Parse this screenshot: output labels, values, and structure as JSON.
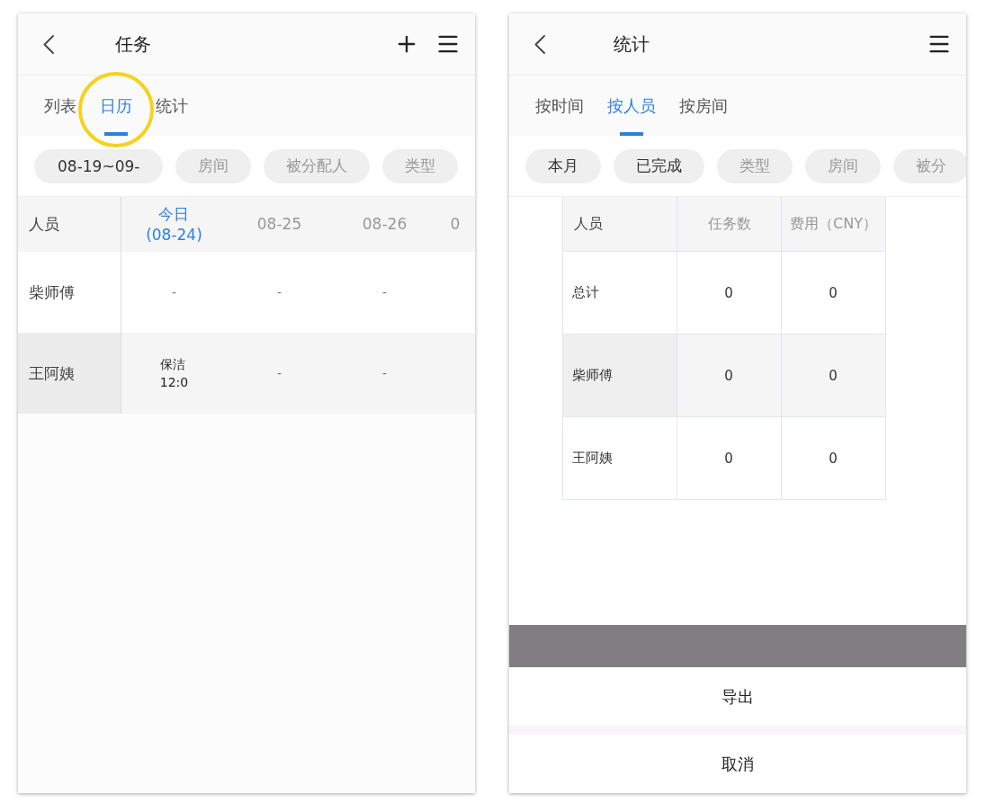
{
  "screens": [
    {
      "title": "任务",
      "add_button": true,
      "tabs": [
        {
          "label": "列表",
          "selected": false,
          "highlight": false
        },
        {
          "label": "日历",
          "selected": true,
          "highlight": true
        },
        {
          "label": "统计",
          "selected": false,
          "highlight": false
        }
      ],
      "filters": [
        {
          "label": "08-19~09-",
          "set": true
        },
        {
          "label": "房间",
          "set": false
        },
        {
          "label": "被分配人",
          "set": false
        },
        {
          "label": "类型",
          "set": false
        }
      ],
      "calendar": {
        "corner": "人员",
        "columns": [
          {
            "label": "今日\n(08-24)",
            "today": true
          },
          {
            "label": "08-25",
            "today": false
          },
          {
            "label": "08-26",
            "today": false
          },
          {
            "label": "0",
            "today": false
          }
        ],
        "rows": [
          {
            "name": "柴师傅",
            "shaded": false,
            "cells": [
              {
                "kind": "empty",
                "text": "-"
              },
              {
                "kind": "empty",
                "text": "-"
              },
              {
                "kind": "empty",
                "text": "-"
              }
            ]
          },
          {
            "name": "王阿姨",
            "shaded": true,
            "cells": [
              {
                "kind": "task",
                "title": "保洁",
                "time": "12:0"
              },
              {
                "kind": "empty",
                "text": "-"
              },
              {
                "kind": "empty",
                "text": "-"
              }
            ]
          }
        ]
      }
    },
    {
      "title": "统计",
      "tabs": [
        {
          "label": "按时间",
          "selected": false,
          "highlight": false
        },
        {
          "label": "按人员",
          "selected": true,
          "highlight": false
        },
        {
          "label": "按房间",
          "selected": false,
          "highlight": false
        }
      ],
      "filters": [
        {
          "label": "本月",
          "set": true
        },
        {
          "label": "已完成",
          "set": true
        },
        {
          "label": "类型",
          "set": false
        },
        {
          "label": "房间",
          "set": false
        },
        {
          "label": "被分",
          "set": false
        }
      ],
      "table": {
        "columns": [
          "人员",
          "任务数",
          "费用（CNY）"
        ],
        "rows": [
          {
            "cells": [
              "总计",
              "0",
              "0"
            ],
            "shaded": false
          },
          {
            "cells": [
              "柴师傅",
              "0",
              "0"
            ],
            "shaded": true
          },
          {
            "cells": [
              "王阿姨",
              "0",
              "0"
            ],
            "shaded": false
          }
        ]
      },
      "action_sheet": {
        "items": [
          "导出"
        ],
        "cancel": "取消"
      }
    }
  ]
}
